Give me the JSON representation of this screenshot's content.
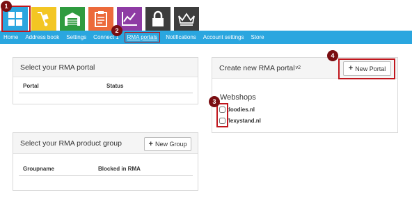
{
  "app_icons": [
    {
      "name": "dashboard",
      "icon": "grid-icon"
    },
    {
      "name": "delivery",
      "icon": "hand-truck-icon"
    },
    {
      "name": "warehouse",
      "icon": "warehouse-icon"
    },
    {
      "name": "orders",
      "icon": "clipboard-icon"
    },
    {
      "name": "statistics",
      "icon": "chart-icon"
    },
    {
      "name": "security",
      "icon": "lock-icon"
    },
    {
      "name": "premium",
      "icon": "crown-icon"
    }
  ],
  "nav": {
    "items": [
      "Home",
      "Address book",
      "Settings",
      "Connect 1",
      "RMA portals",
      "Notifications",
      "Account settings",
      "Store"
    ],
    "active": "RMA portals"
  },
  "markers": [
    "1",
    "2",
    "3",
    "4"
  ],
  "rma_portal_panel": {
    "title": "Select your RMA portal",
    "col_portal": "Portal",
    "col_status": "Status"
  },
  "rma_group_panel": {
    "title": "Select your RMA product group",
    "button": "New Group",
    "col_groupname": "Groupname",
    "col_blocked": "Blocked in RMA"
  },
  "create_panel": {
    "title": "Create new RMA portal",
    "version": "v2",
    "button": "New Portal",
    "webshops_label": "Webshops",
    "webshops": [
      "doodies.nl",
      "flexystand.nl"
    ]
  },
  "colors": {
    "nav_bg": "#2aa6df",
    "highlight": "#c0161d",
    "marker": "#7a0e12"
  }
}
